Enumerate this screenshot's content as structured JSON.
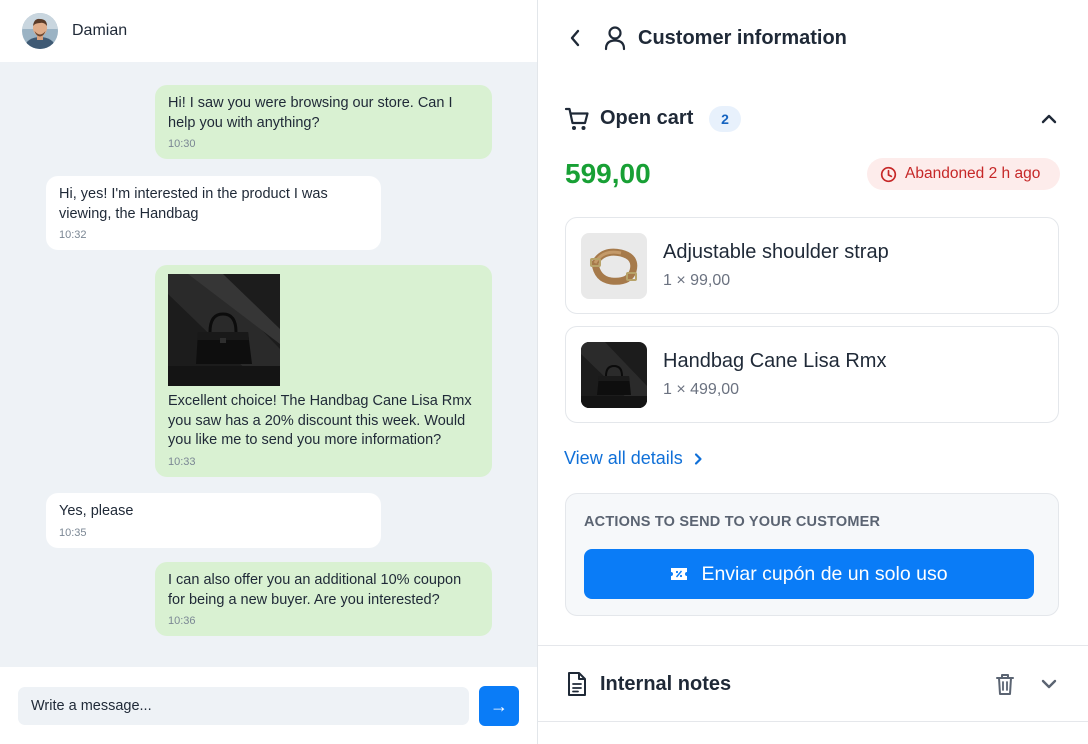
{
  "chat": {
    "contact_name": "Damian",
    "messages": [
      {
        "direction": "out",
        "text": "Hi! I saw you were browsing our store. Can I help you with anything?",
        "time": "10:30"
      },
      {
        "direction": "in",
        "text": "Hi, yes! I'm interested in the product I was viewing, the Handbag",
        "time": "10:32"
      },
      {
        "direction": "out",
        "text": "Excellent choice! The Handbag Cane Lisa Rmx you saw has a 20% discount this week. Would you like me to send you more information?",
        "time": "10:33",
        "image": "handbag-photo"
      },
      {
        "direction": "in",
        "text": "Yes, please",
        "time": "10:35"
      },
      {
        "direction": "out",
        "text": "I can also offer you an additional 10% coupon for being a new buyer. Are you interested?",
        "time": "10:36"
      }
    ],
    "composer": {
      "placeholder": "Write a message...",
      "send_icon": "→"
    }
  },
  "panel": {
    "title": "Customer information",
    "back_icon": "chevron-left-icon",
    "user_icon": "user-icon"
  },
  "cart": {
    "title": "Open cart",
    "count": "2",
    "total": "599,00",
    "abandoned_label": "Abandoned 2 h ago",
    "items": [
      {
        "name": "Adjustable shoulder strap",
        "price": "1 × 99,00",
        "thumb": "strap-thumbnail"
      },
      {
        "name": "Handbag Cane Lisa Rmx",
        "price": "1 × 499,00",
        "thumb": "handbag-thumbnail"
      }
    ],
    "view_details": "View all details"
  },
  "actions": {
    "title": "ACTIONS TO SEND TO YOUR CUSTOMER",
    "coupon_button": "Enviar cupón de un solo uso"
  },
  "notes": {
    "title": "Internal notes"
  },
  "colors": {
    "accent": "#0a7cf7",
    "link": "#1070d8",
    "total_green": "#18a035",
    "badge_red": "#c62828",
    "outgoing_bubble": "#d9f1d2",
    "chat_background": "#eef2f6"
  }
}
